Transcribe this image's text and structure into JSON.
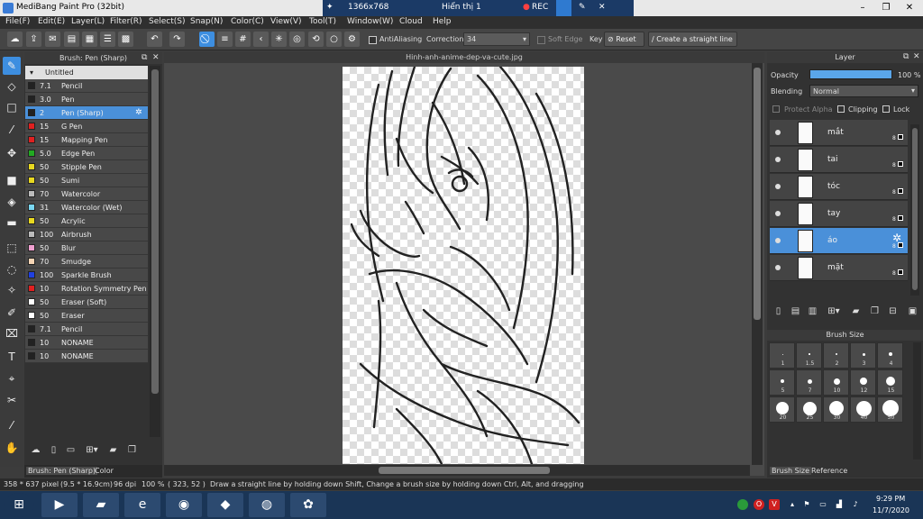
{
  "window": {
    "title": "MediBang Paint Pro (32bit)",
    "resolution": "1366x768",
    "display_label": "Hiển thị 1",
    "rec_label": "REC"
  },
  "menu": [
    "File(F)",
    "Edit(E)",
    "Layer(L)",
    "Filter(R)",
    "Select(S)",
    "Snap(N)",
    "Color(C)",
    "View(V)",
    "Tool(T)",
    "Window(W)",
    "Cloud",
    "Help"
  ],
  "toolbar": {
    "antialias_label": "AntiAliasing",
    "correction_label": "Correction",
    "correction_value": "34",
    "soft_edge_label": "Soft Edge",
    "key_label": "Key",
    "reset_label": "Reset",
    "straight_line_label": "Create a straight line"
  },
  "brush_panel": {
    "title": "Brush: Pen (Sharp)",
    "group": "Untitled",
    "brushes": [
      {
        "size": "7.1",
        "name": "Pencil",
        "color": "#222222"
      },
      {
        "size": "3.0",
        "name": "Pen",
        "color": "#222222"
      },
      {
        "size": "2",
        "name": "Pen (Sharp)",
        "color": "#222222"
      },
      {
        "size": "15",
        "name": "G Pen",
        "color": "#e02020"
      },
      {
        "size": "15",
        "name": "Mapping Pen",
        "color": "#e02020"
      },
      {
        "size": "5.0",
        "name": "Edge Pen",
        "color": "#22aa22"
      },
      {
        "size": "50",
        "name": "Stipple Pen",
        "color": "#e8d820"
      },
      {
        "size": "50",
        "name": "Sumi",
        "color": "#e8d820"
      },
      {
        "size": "70",
        "name": "Watercolor",
        "color": "#bbbbbb"
      },
      {
        "size": "31",
        "name": "Watercolor (Wet)",
        "color": "#7ad6f0"
      },
      {
        "size": "50",
        "name": "Acrylic",
        "color": "#e8d820"
      },
      {
        "size": "100",
        "name": "Airbrush",
        "color": "#bbbbbb"
      },
      {
        "size": "50",
        "name": "Blur",
        "color": "#f0a0d0"
      },
      {
        "size": "70",
        "name": "Smudge",
        "color": "#f5d5b5"
      },
      {
        "size": "100",
        "name": "Sparkle Brush",
        "color": "#2040e0"
      },
      {
        "size": "10",
        "name": "Rotation Symmetry Pen",
        "color": "#e02020"
      },
      {
        "size": "50",
        "name": "Eraser (Soft)",
        "color": "#ffffff"
      },
      {
        "size": "50",
        "name": "Eraser",
        "color": "#ffffff"
      },
      {
        "size": "7.1",
        "name": "Pencil",
        "color": "#222222"
      },
      {
        "size": "10",
        "name": "NONAME",
        "color": "#222222"
      },
      {
        "size": "10",
        "name": "NONAME",
        "color": "#222222"
      }
    ],
    "footer_tab_active": "Brush: Pen (Sharp)",
    "footer_tab_other": "Color"
  },
  "canvas": {
    "doc_name": "Hinh-anh-anime-dep-va-cute.jpg"
  },
  "layer_panel": {
    "title": "Layer",
    "opacity_label": "Opacity",
    "opacity_value": "100 %",
    "opacity_level": 1.0,
    "blending_label": "Blending",
    "blending_value": "Normal",
    "protect_alpha_label": "Protect Alpha",
    "clipping_label": "Clipping",
    "lock_label": "Lock",
    "layers": [
      {
        "name": "mắt",
        "opacity": "8"
      },
      {
        "name": "tai",
        "opacity": "8"
      },
      {
        "name": "tóc",
        "opacity": "8"
      },
      {
        "name": "tay",
        "opacity": "8"
      },
      {
        "name": "áo",
        "opacity": "8"
      },
      {
        "name": "mặt",
        "opacity": "8"
      }
    ]
  },
  "brush_size_panel": {
    "title": "Brush Size",
    "sizes": [
      "1",
      "1.5",
      "2",
      "3",
      "4",
      "5",
      "7",
      "10",
      "12",
      "15",
      "20",
      "25",
      "30",
      "40",
      "50"
    ],
    "tab_active": "Brush Size",
    "tab_other": "Reference"
  },
  "status": {
    "dimensions": "358 * 637 pixel",
    "physical": "(9.5 * 16.9cm)",
    "dpi": "96 dpi",
    "zoom": "100 %",
    "coords": "( 323, 52 )",
    "hint": "Draw a straight line by holding down Shift, Change a brush size by holding down Ctrl, Alt, and dragging"
  },
  "taskbar": {
    "time": "9:29 PM",
    "date": "11/7/2020"
  }
}
